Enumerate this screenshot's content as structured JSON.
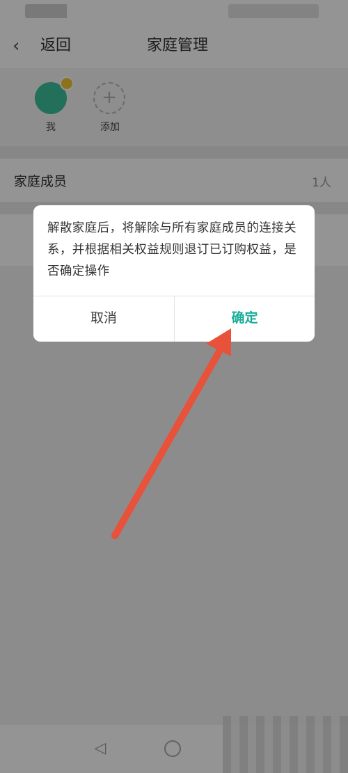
{
  "nav": {
    "back_label": "返回",
    "title": "家庭管理"
  },
  "members": {
    "first_label": "我",
    "add_label": "添加"
  },
  "family_row": {
    "label": "家庭成员",
    "value": "1人"
  },
  "dialog": {
    "message": "解散家庭后，将解除与所有家庭成员的连接关系，并根据相关权益规则退订已订购权益，是否确定操作",
    "cancel_label": "取消",
    "confirm_label": "确定"
  },
  "colors": {
    "accent": "#1aad99",
    "arrow": "#e8513a",
    "avatar": "#3cbf9b",
    "badge": "#f4c430"
  },
  "icons": {
    "back": "chevron-left-icon",
    "add": "plus-icon",
    "home": "home-circle-icon",
    "arrow": "red-arrow-annotation"
  }
}
